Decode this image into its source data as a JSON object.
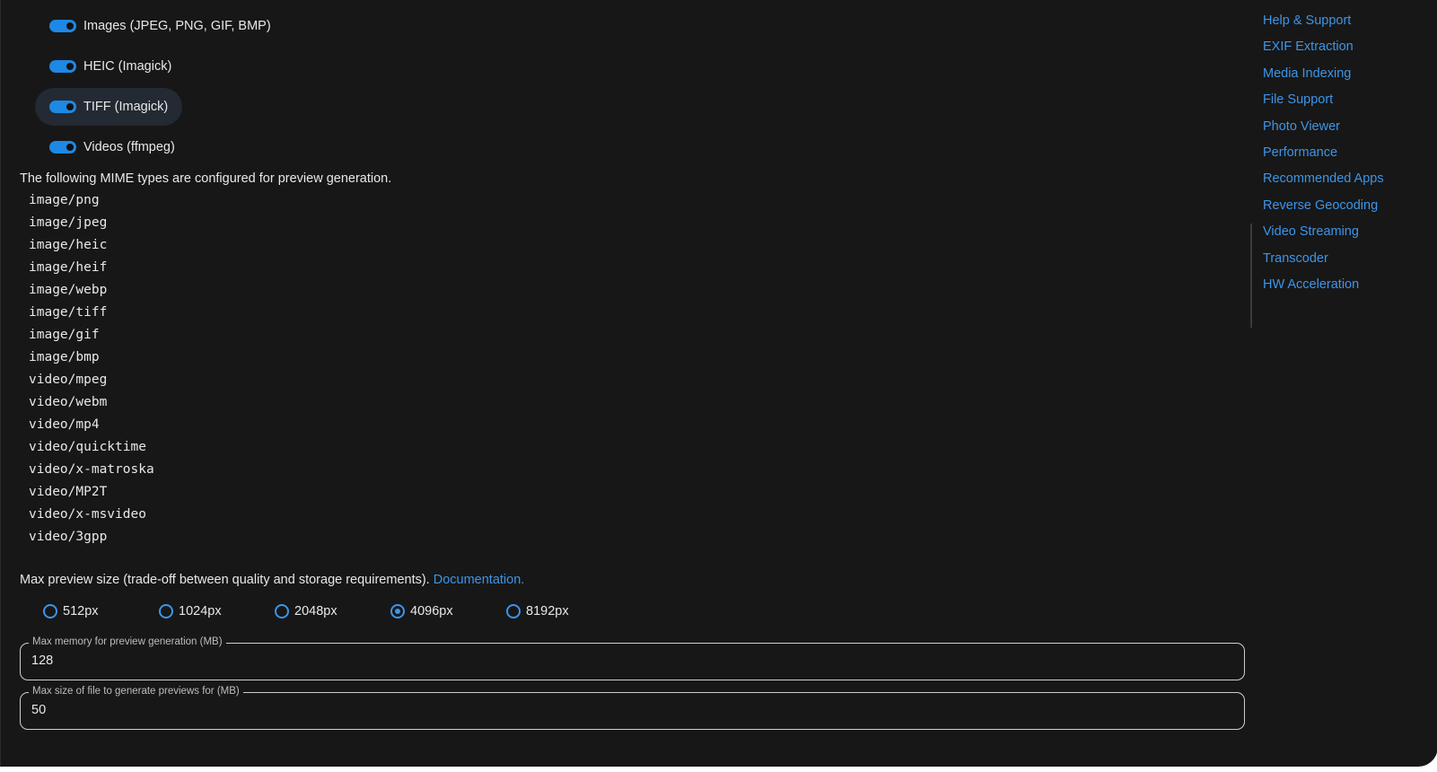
{
  "toggles": [
    {
      "label": "Images (JPEG, PNG, GIF, BMP)",
      "enabled": true
    },
    {
      "label": "HEIC (Imagick)",
      "enabled": true
    },
    {
      "label": "TIFF (Imagick)",
      "enabled": true
    },
    {
      "label": "Videos (ffmpeg)",
      "enabled": true
    }
  ],
  "mime_description": "The following MIME types are configured for preview generation.",
  "mime_types": [
    "image/png",
    "image/jpeg",
    "image/heic",
    "image/heif",
    "image/webp",
    "image/tiff",
    "image/gif",
    "image/bmp",
    "video/mpeg",
    "video/webm",
    "video/mp4",
    "video/quicktime",
    "video/x-matroska",
    "video/MP2T",
    "video/x-msvideo",
    "video/3gpp"
  ],
  "preview_size": {
    "description": "Max preview size (trade-off between quality and storage requirements).",
    "doc_link": "Documentation.",
    "options": [
      "512px",
      "1024px",
      "2048px",
      "4096px",
      "8192px"
    ],
    "selected": "4096px"
  },
  "fields": {
    "max_memory": {
      "label": "Max memory for preview generation (MB)",
      "value": "128"
    },
    "max_file_size": {
      "label": "Max size of file to generate previews for (MB)",
      "value": "50"
    }
  },
  "toc": [
    "Help & Support",
    "EXIF Extraction",
    "Media Indexing",
    "File Support",
    "Photo Viewer",
    "Performance",
    "Recommended Apps",
    "Reverse Geocoding",
    "Video Streaming",
    "Transcoder",
    "HW Acceleration"
  ],
  "colors": {
    "background": "#171717",
    "accent": "#3d95e8",
    "switch_on": "#1e88e5",
    "text": "#e8e8e8"
  }
}
